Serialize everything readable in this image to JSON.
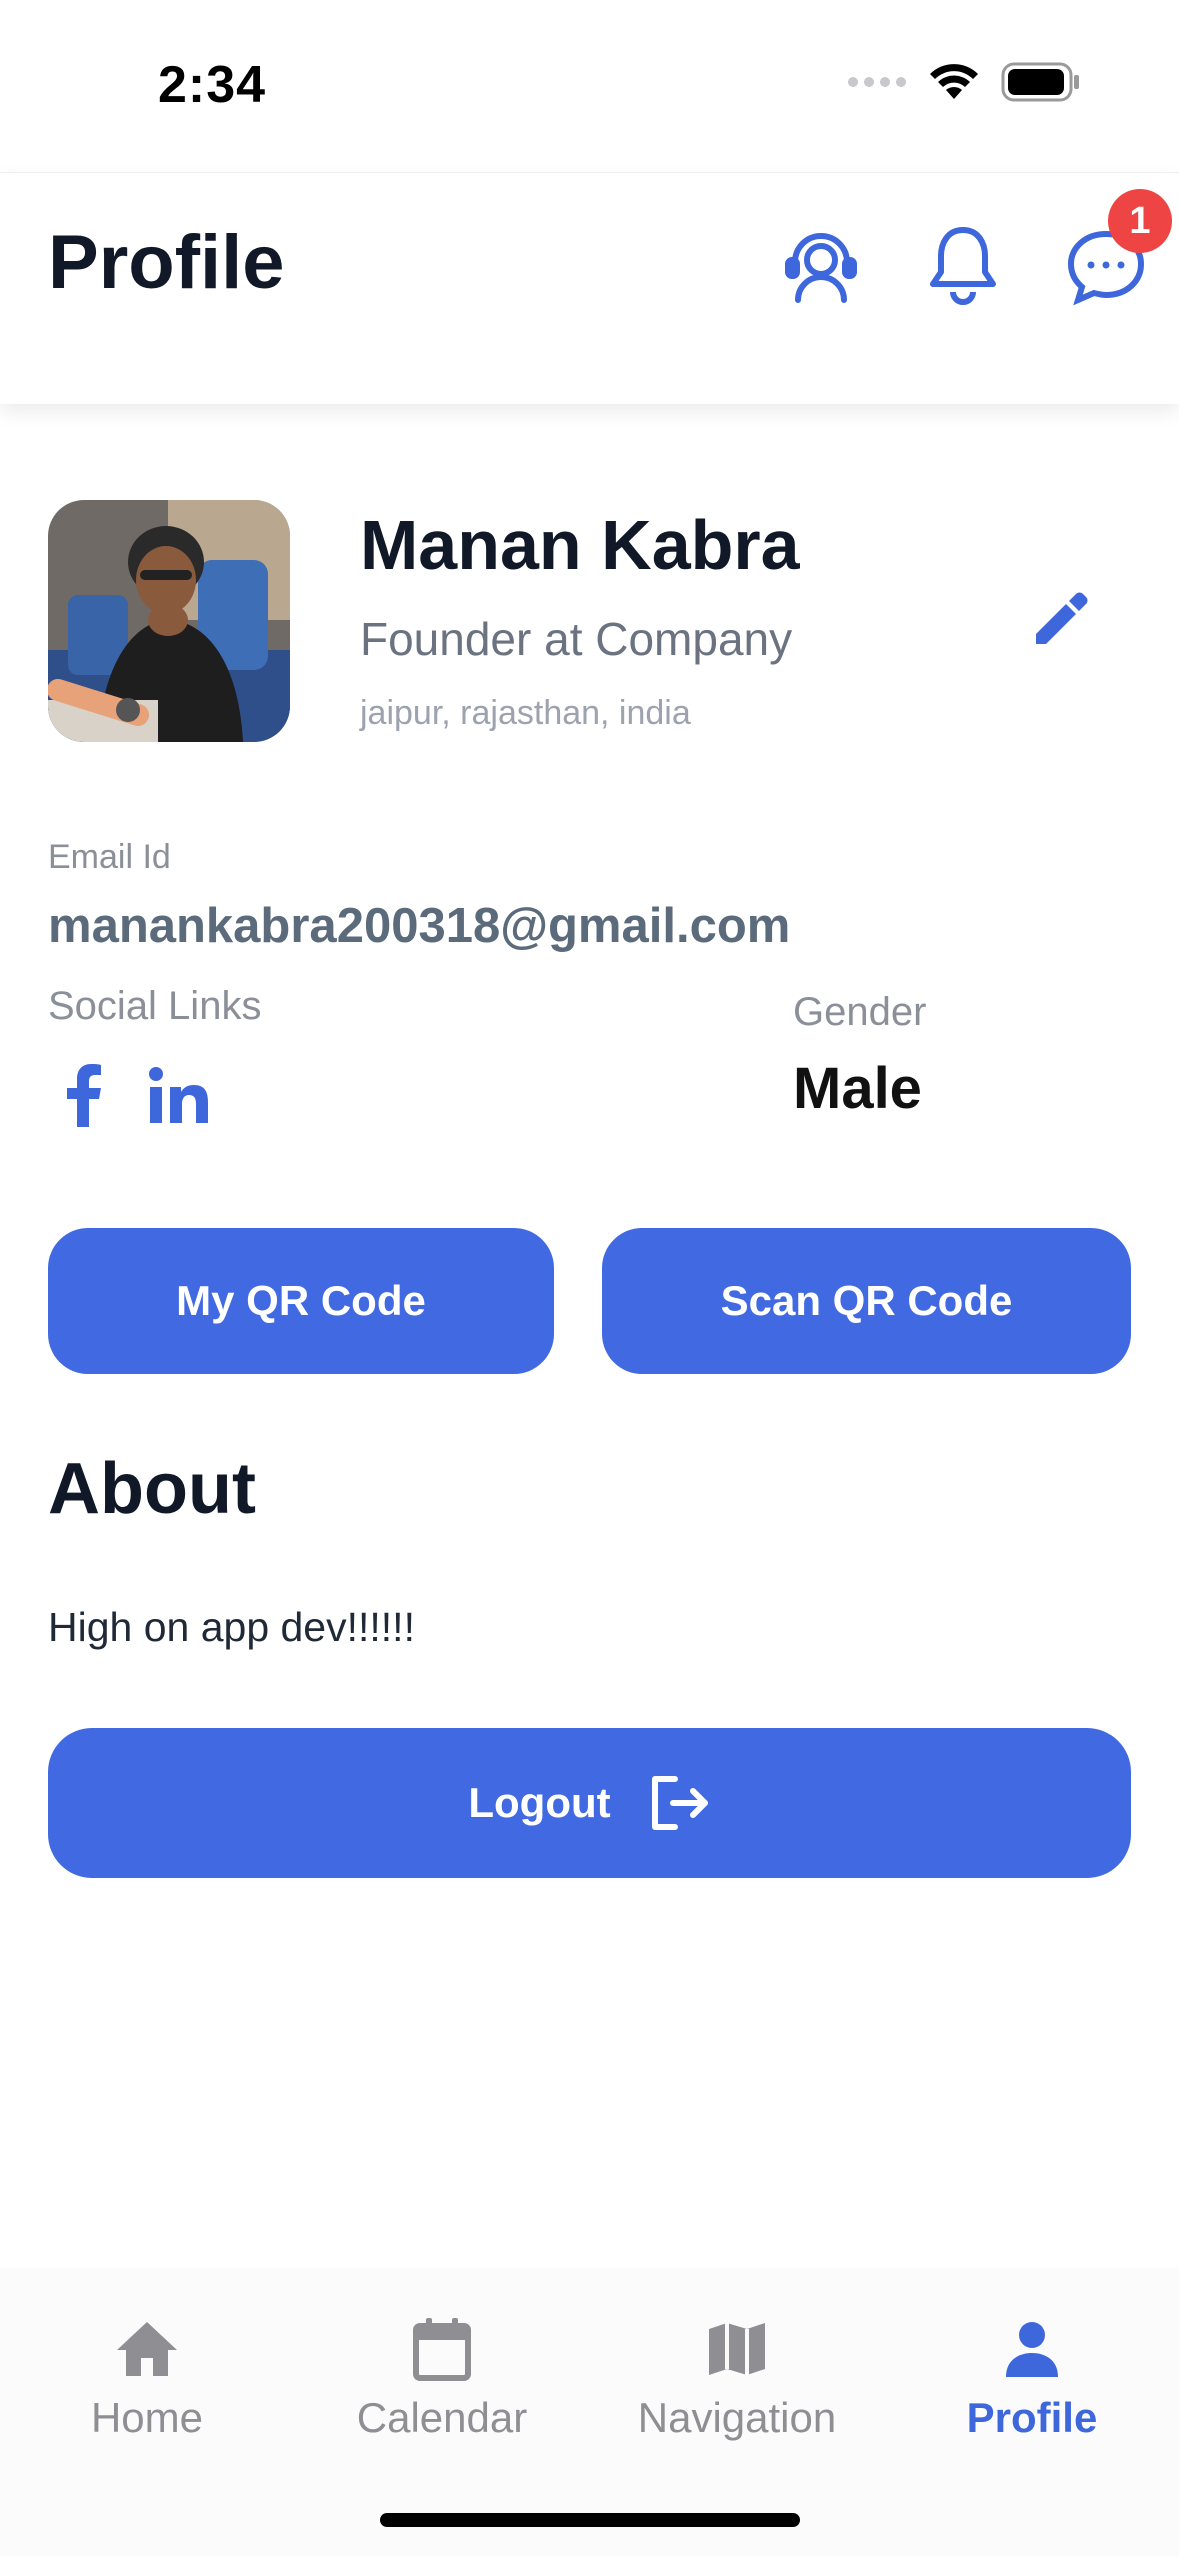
{
  "status_bar": {
    "time": "2:34"
  },
  "header": {
    "title": "Profile",
    "chat_badge": "1"
  },
  "profile": {
    "name": "Manan Kabra",
    "role": "Founder at Company",
    "location": "jaipur, rajasthan, india"
  },
  "details": {
    "email_label": "Email Id",
    "email_value": "manankabra200318@gmail.com",
    "social_label": "Social Links",
    "gender_label": "Gender",
    "gender_value": "Male"
  },
  "actions": {
    "my_qr_label": "My QR Code",
    "scan_qr_label": "Scan QR Code",
    "logout_label": "Logout"
  },
  "about": {
    "title": "About",
    "text": "High on app dev!!!!!!"
  },
  "bottom_nav": {
    "items": [
      {
        "label": "Home",
        "icon": "home-icon"
      },
      {
        "label": "Calendar",
        "icon": "calendar-icon"
      },
      {
        "label": "Navigation",
        "icon": "map-icon"
      },
      {
        "label": "Profile",
        "icon": "person-icon"
      }
    ],
    "active": "Profile"
  },
  "colors": {
    "accent": "#4169e1",
    "badge": "#ef4444",
    "text_primary": "#111827",
    "text_muted": "#8a8f98"
  }
}
